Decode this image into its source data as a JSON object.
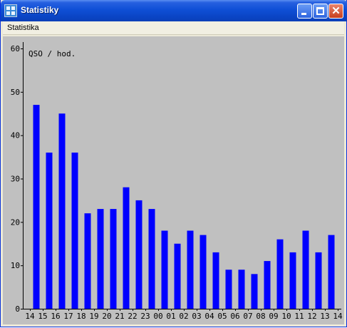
{
  "window": {
    "title": "Statistiky"
  },
  "menu": {
    "items": [
      {
        "label": "Statistika"
      }
    ]
  },
  "colors": {
    "bar": "#0000ff",
    "background": "#c0c0c0",
    "axis": "#000000"
  },
  "chart_data": {
    "type": "bar",
    "title": "QSO / hod.",
    "categories": [
      "14",
      "15",
      "16",
      "17",
      "18",
      "19",
      "20",
      "21",
      "22",
      "23",
      "00",
      "01",
      "02",
      "03",
      "04",
      "05",
      "06",
      "07",
      "08",
      "09",
      "10",
      "11",
      "12",
      "13",
      "14"
    ],
    "values": [
      47,
      36,
      45,
      36,
      22,
      23,
      23,
      28,
      25,
      23,
      18,
      15,
      18,
      17,
      13,
      9,
      9,
      8,
      11,
      16,
      13,
      18,
      13,
      17
    ],
    "ylim": [
      0,
      60
    ],
    "yticks": [
      0,
      10,
      20,
      30,
      40,
      50,
      60
    ],
    "grid": false
  }
}
